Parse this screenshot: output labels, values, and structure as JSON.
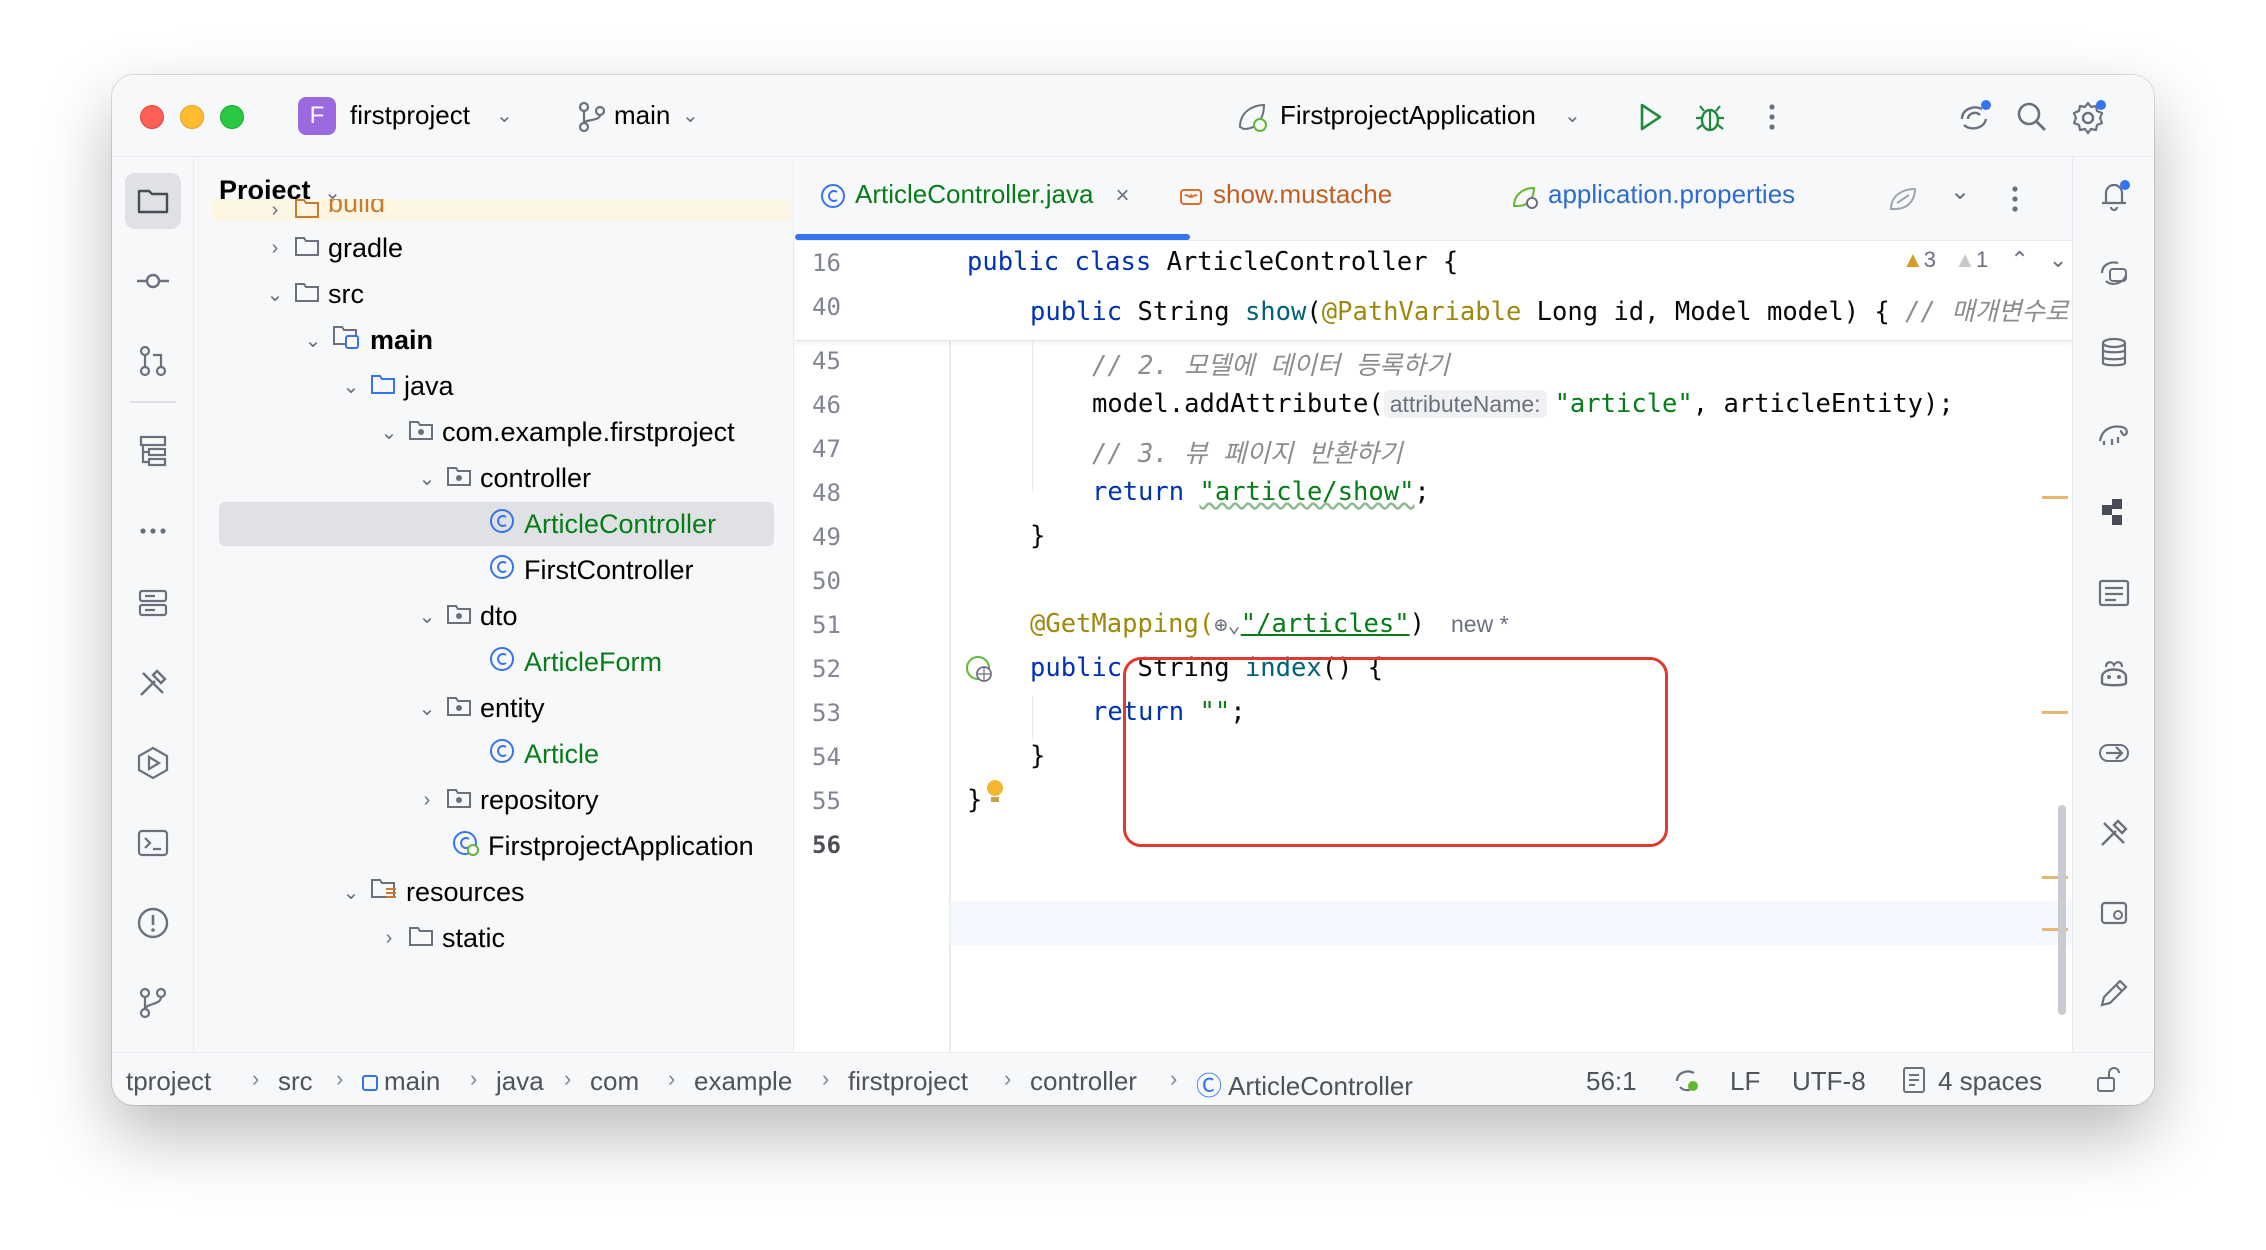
{
  "titlebar": {
    "project_initial": "F",
    "project_name": "firstproject",
    "branch": "main",
    "run_config": "FirstprojectApplication"
  },
  "project_panel": {
    "title": "Project",
    "items": [
      {
        "label": "build"
      },
      {
        "label": "gradle"
      },
      {
        "label": "src"
      },
      {
        "label": "main"
      },
      {
        "label": "java"
      },
      {
        "label": "com.example.firstproject"
      },
      {
        "label": "controller"
      },
      {
        "label": "ArticleController"
      },
      {
        "label": "FirstController"
      },
      {
        "label": "dto"
      },
      {
        "label": "ArticleForm"
      },
      {
        "label": "entity"
      },
      {
        "label": "Article"
      },
      {
        "label": "repository"
      },
      {
        "label": "FirstprojectApplication"
      },
      {
        "label": "resources"
      },
      {
        "label": "static"
      }
    ]
  },
  "tabs": [
    {
      "label": "ArticleController.java",
      "active": true
    },
    {
      "label": "show.mustache"
    },
    {
      "label": "application.properties"
    }
  ],
  "inspections": {
    "warnings": "3",
    "weak_warnings": "1"
  },
  "editor": {
    "lines": {
      "l16": "16",
      "l40": "40",
      "l45": "45",
      "l46": "46",
      "l47": "47",
      "l48": "48",
      "l49": "49",
      "l50": "50",
      "l51": "51",
      "l52": "52",
      "l53": "53",
      "l54": "54",
      "l55": "55",
      "l56": "56"
    },
    "code": {
      "c16_kw": "public class",
      "c16_rest": " ArticleController {",
      "c40_kw": "public",
      "c40_a": " String ",
      "c40_fn": "show",
      "c40_b": "(",
      "c40_ann": "@PathVariable",
      "c40_c": " Long id, Model model) { ",
      "c40_cmt": "// 매개변수로",
      "c45_cmt": "// 2. 모델에 데이터 등록하기",
      "c46_a": "model.addAttribute(",
      "c46_hint": "attributeName:",
      "c46_str": "\"article\"",
      "c46_b": ", articleEntity);",
      "c47_cmt": "// 3. 뷰 페이지 반환하기",
      "c48_kw": "return",
      "c48_str": "\"article/show\"",
      "c48_b": ";",
      "c49": "}",
      "c51_ann": "@GetMapping(",
      "c51_str": "\"/articles\"",
      "c51_b": ")",
      "c51_new": "new *",
      "c52_kw": "public",
      "c52_a": " String ",
      "c52_fn": "index",
      "c52_b": "() {",
      "c53_kw": "return",
      "c53_str": "\"\"",
      "c53_b": ";",
      "c54": "}",
      "c55": "}"
    }
  },
  "breadcrumbs": [
    "tproject",
    "src",
    "main",
    "java",
    "com",
    "example",
    "firstproject",
    "controller",
    "ArticleController"
  ],
  "status": {
    "position": "56:1",
    "line_sep": "LF",
    "encoding": "UTF-8",
    "indent": "4 spaces"
  },
  "colors": {
    "accent": "#3574f0",
    "highlight": "#e0392f",
    "keyword": "#0033b3",
    "string": "#067d17",
    "annotation": "#9e880d"
  }
}
